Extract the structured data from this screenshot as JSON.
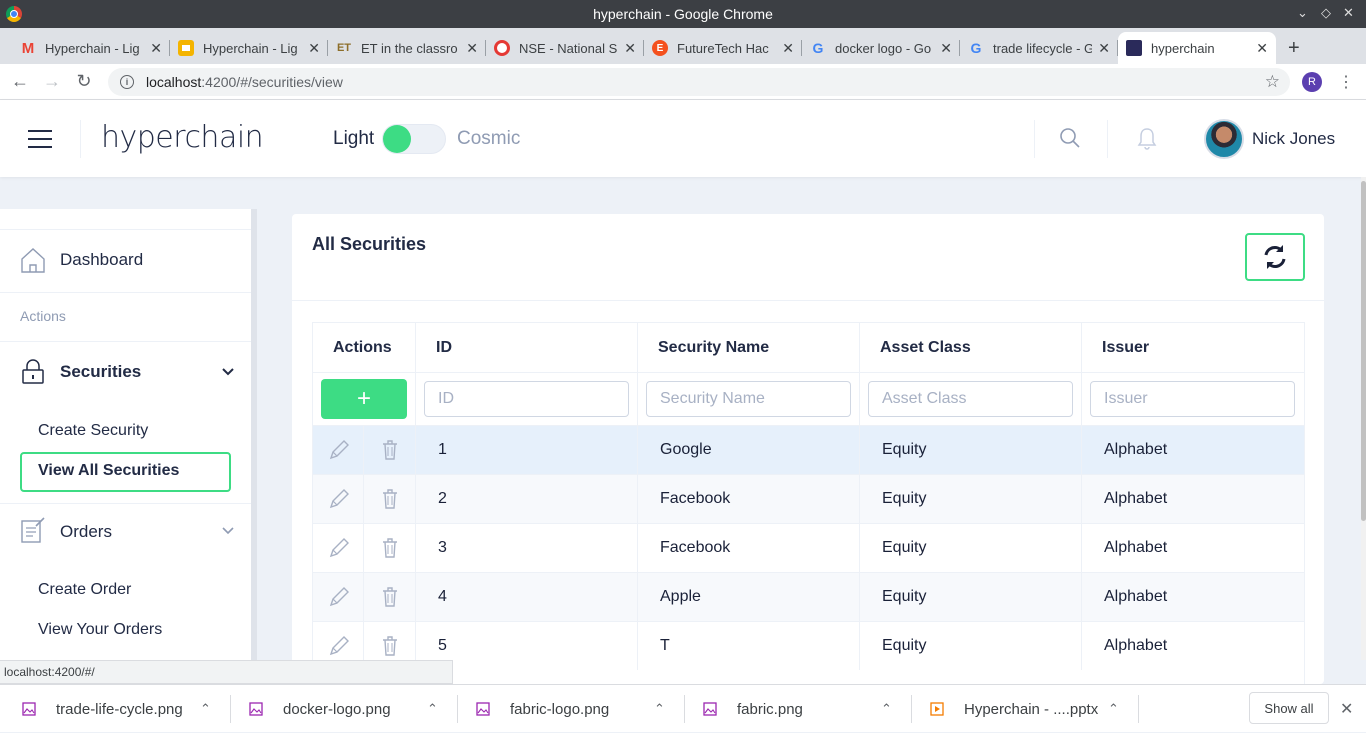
{
  "window": {
    "title": "hyperchain - Google Chrome"
  },
  "tabs": [
    {
      "label": "Hyperchain - Lig",
      "icon": "gmail-icon",
      "color": "#ea4335"
    },
    {
      "label": "Hyperchain - Lig",
      "icon": "slides-icon",
      "color": "#f4b400"
    },
    {
      "label": "ET in the classro",
      "icon": "et-icon",
      "color": "#8d6e2a"
    },
    {
      "label": "NSE - National S",
      "icon": "nse-icon",
      "color": "#e53935"
    },
    {
      "label": "FutureTech Hac",
      "icon": "e-icon",
      "color": "#f4511e"
    },
    {
      "label": "docker logo - Go",
      "icon": "google-icon",
      "color": "#4285f4"
    },
    {
      "label": "trade lifecycle - G",
      "icon": "google-icon",
      "color": "#4285f4"
    },
    {
      "label": "hyperchain",
      "icon": "hyperchain-icon",
      "color": "#2a2a5a"
    }
  ],
  "address": {
    "host": "localhost",
    "path": ":4200/#/securities/view",
    "profile_initial": "R"
  },
  "header": {
    "brand": "hyperchain",
    "theme_light": "Light",
    "theme_cosmic": "Cosmic",
    "user_name": "Nick Jones"
  },
  "sidebar": {
    "dashboard": "Dashboard",
    "actions_heading": "Actions",
    "securities": "Securities",
    "create_security": "Create Security",
    "view_all_securities": "View All Securities",
    "orders": "Orders",
    "create_order": "Create Order",
    "view_your_orders": "View Your Orders"
  },
  "status_url": "localhost:4200/#/",
  "card": {
    "title": "All Securities"
  },
  "table": {
    "columns": [
      "Actions",
      "ID",
      "Security Name",
      "Asset Class",
      "Issuer"
    ],
    "placeholders": {
      "id": "ID",
      "name": "Security Name",
      "asset": "Asset Class",
      "issuer": "Issuer"
    },
    "add_label": "+",
    "rows": [
      {
        "id": "1",
        "name": "Google",
        "asset": "Equity",
        "issuer": "Alphabet"
      },
      {
        "id": "2",
        "name": "Facebook",
        "asset": "Equity",
        "issuer": "Alphabet"
      },
      {
        "id": "3",
        "name": "Facebook",
        "asset": "Equity",
        "issuer": "Alphabet"
      },
      {
        "id": "4",
        "name": "Apple",
        "asset": "Equity",
        "issuer": "Alphabet"
      },
      {
        "id": "5",
        "name": "T",
        "asset": "Equity",
        "issuer": "Alphabet"
      }
    ]
  },
  "downloads": [
    {
      "name": "trade-life-cycle.png",
      "icon": "image-file-icon"
    },
    {
      "name": "docker-logo.png",
      "icon": "image-file-icon"
    },
    {
      "name": "fabric-logo.png",
      "icon": "image-file-icon"
    },
    {
      "name": "fabric.png",
      "icon": "image-file-icon"
    },
    {
      "name": "Hyperchain - ....pptx",
      "icon": "slides-file-icon"
    }
  ],
  "downloads_show_all": "Show all",
  "colors": {
    "accent": "#3ddc84",
    "highlight_row": "#e6f0fb",
    "text": "#222b45"
  }
}
